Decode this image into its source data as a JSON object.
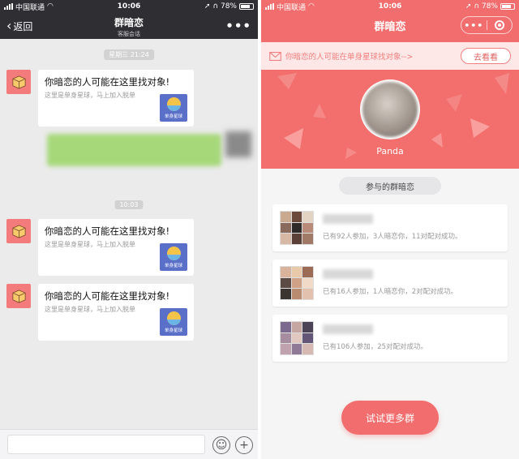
{
  "left": {
    "status": {
      "carrier": "中国联通",
      "time": "10:06",
      "battery": "78%"
    },
    "nav": {
      "back_label": "返回",
      "title": "群暗恋",
      "subtitle": "客服会话",
      "more_label": "•••"
    },
    "timestamps": [
      "星期三 21:24",
      "10:03"
    ],
    "messages": [
      {
        "title": "你暗恋的人可能在这里找对象!",
        "desc": "这里是单身星球，马上加入脱单",
        "thumb_label": "单身星球"
      },
      {
        "title": "你暗恋的人可能在这里找对象!",
        "desc": "这里是单身星球，马上加入脱单",
        "thumb_label": "单身星球"
      },
      {
        "title": "你暗恋的人可能在这里找对象!",
        "desc": "这里是单身星球，马上加入脱单",
        "thumb_label": "单身星球"
      }
    ]
  },
  "right": {
    "status": {
      "carrier": "中国联通",
      "time": "10:06",
      "battery": "78%"
    },
    "title": "群暗恋",
    "capsule_more": "•••",
    "notice": {
      "text": "你暗恋的人可能在单身星球找对象-->",
      "button": "去看看"
    },
    "profile": {
      "name": "Panda"
    },
    "section_label": "参与的群暗恋",
    "groups": [
      {
        "stat": "已有92人参加，3人暗恋你，11对配对成功。"
      },
      {
        "stat": "已有16人参加，1人暗恋你，2对配对成功。"
      },
      {
        "stat": "已有106人参加，25对配对成功。"
      }
    ],
    "more_button": "试试更多群"
  },
  "colors": {
    "accent": "#f26d6d",
    "wechat_nav": "#2e2e33",
    "chat_bg": "#ebebeb",
    "notice_text": "#f0807f"
  }
}
